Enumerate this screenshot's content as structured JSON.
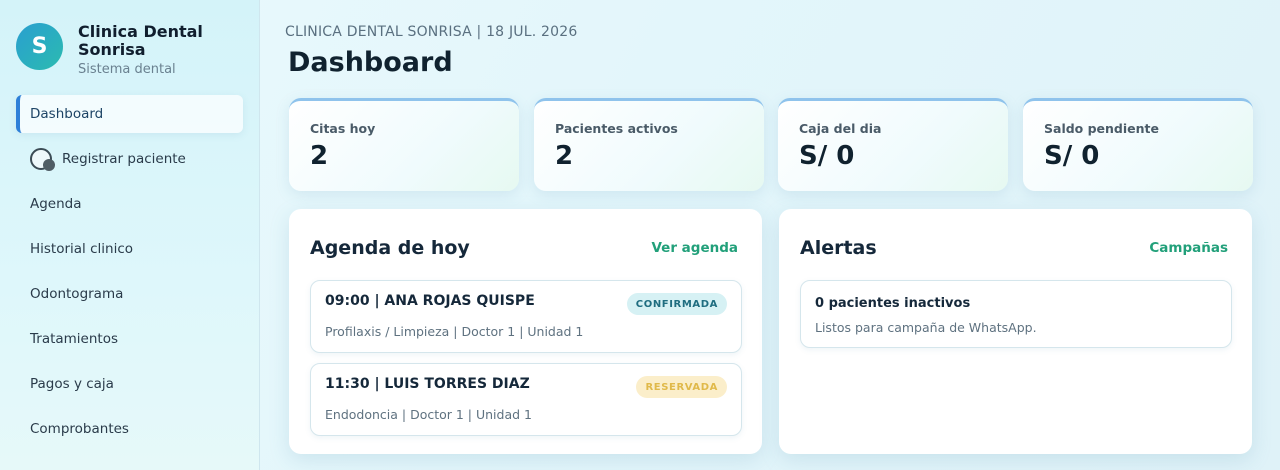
{
  "brand": {
    "initial": "S",
    "name": "Clinica Dental Sonrisa",
    "subtitle": "Sistema dental"
  },
  "sidebar": {
    "items": [
      {
        "label": "Dashboard",
        "active": true
      },
      {
        "label": "Registrar paciente",
        "icon": "toggle-circle-icon"
      },
      {
        "label": "Agenda"
      },
      {
        "label": "Historial clinico"
      },
      {
        "label": "Odontograma"
      },
      {
        "label": "Tratamientos"
      },
      {
        "label": "Pagos y caja"
      },
      {
        "label": "Comprobantes"
      }
    ]
  },
  "header": {
    "eyebrow": "CLINICA DENTAL SONRISA | 18 JUL. 2026",
    "title": "Dashboard"
  },
  "stats": [
    {
      "label": "Citas hoy",
      "value": "2"
    },
    {
      "label": "Pacientes activos",
      "value": "2"
    },
    {
      "label": "Caja del dia",
      "value": "S/ 0"
    },
    {
      "label": "Saldo pendiente",
      "value": "S/ 0"
    }
  ],
  "agenda": {
    "title": "Agenda de hoy",
    "link": "Ver agenda",
    "appointments": [
      {
        "title": "09:00 | ANA ROJAS QUISPE",
        "detail": "Profilaxis / Limpieza | Doctor 1 | Unidad 1",
        "status": "CONFIRMADA"
      },
      {
        "title": "11:30 | LUIS TORRES DIAZ",
        "detail": "Endodoncia | Doctor 1 | Unidad 1",
        "status": "RESERVADA"
      }
    ]
  },
  "alerts": {
    "title": "Alertas",
    "link": "Campañas",
    "items": [
      {
        "title": "0 pacientes inactivos",
        "detail": "Listos para campaña de WhatsApp."
      }
    ]
  },
  "colors": {
    "accent": "#2d7fd8",
    "link": "#22a07a",
    "confirmed_bg": "#d6f1f4",
    "reserved_bg": "#fbeeca"
  }
}
